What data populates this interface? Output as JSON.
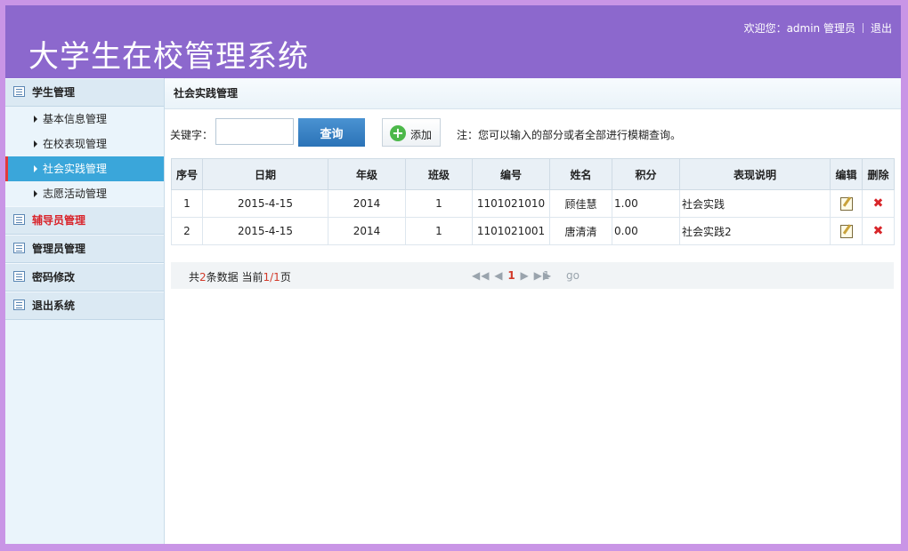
{
  "header": {
    "title": "大学生在校管理系统",
    "welcome": "欢迎您：admin 管理员",
    "logout": "退出"
  },
  "sidebar": {
    "groups": [
      {
        "label": "学生管理",
        "items": [
          "基本信息管理",
          "在校表现管理",
          "社会实践管理",
          "志愿活动管理"
        ],
        "active_item": 2
      },
      {
        "label": "辅导员管理"
      },
      {
        "label": "管理员管理"
      },
      {
        "label": "密码修改"
      },
      {
        "label": "退出系统"
      }
    ]
  },
  "breadcrumb": "社会实践管理",
  "search": {
    "label": "关键字：",
    "value": "",
    "query_button": "查询",
    "add_button": "添加",
    "hint": "注：您可以输入的部分或者全部进行模糊查询。"
  },
  "table": {
    "headers": [
      "序号",
      "日期",
      "年级",
      "班级",
      "编号",
      "姓名",
      "积分",
      "表现说明",
      "编辑",
      "删除"
    ],
    "rows": [
      [
        "1",
        "2015-4-15",
        "2014",
        "1",
        "1101021010",
        "顾佳慧",
        "1.00",
        "社会实践"
      ],
      [
        "2",
        "2015-4-15",
        "2014",
        "1",
        "1101021001",
        "唐清清",
        "0.00",
        "社会实践2"
      ]
    ]
  },
  "pager": {
    "total_prefix": "共",
    "total": "2",
    "total_suffix": "条数据 当前",
    "current": "1",
    "slash": "/",
    "pages": "1",
    "pages_suffix": "页",
    "nav_first": "◀◀",
    "nav_prev": "◀",
    "current_page": "1",
    "nav_next": "▶",
    "nav_last": "▶▶",
    "goto_value": "1",
    "go": "go"
  },
  "colors": {
    "header": "#8c68cd",
    "active_menu": "#3aa6da",
    "query_button": "#2b73b7",
    "accent_red": "#d9232a"
  }
}
